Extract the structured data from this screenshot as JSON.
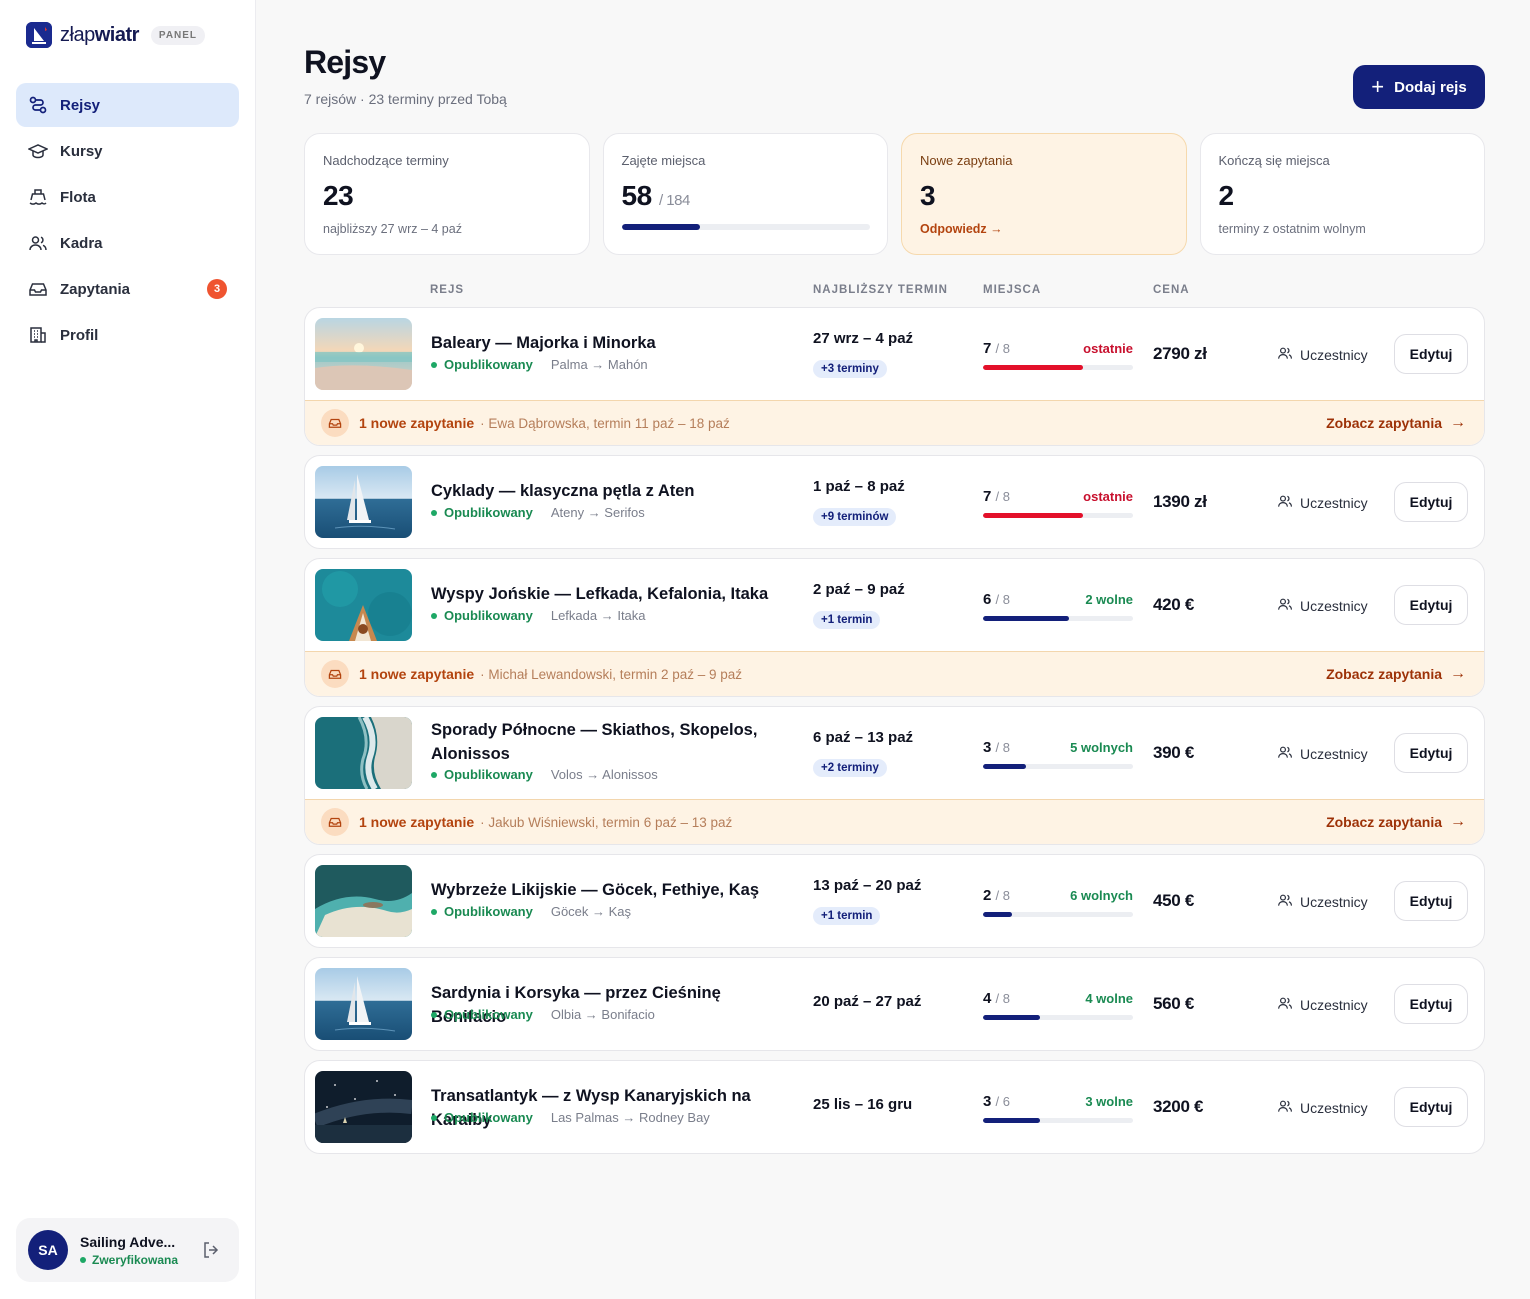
{
  "brand": {
    "name_light": "złap",
    "name_bold": "wiatr",
    "badge": "PANEL"
  },
  "nav": [
    {
      "label": "Rejsy",
      "icon": "route-icon",
      "active": true
    },
    {
      "label": "Kursy",
      "icon": "graduation-cap-icon"
    },
    {
      "label": "Flota",
      "icon": "boat-icon"
    },
    {
      "label": "Kadra",
      "icon": "users-icon"
    },
    {
      "label": "Zapytania",
      "icon": "inbox-icon",
      "badge": "3"
    },
    {
      "label": "Profil",
      "icon": "building-icon"
    }
  ],
  "account": {
    "initials": "SA",
    "name": "Sailing Adve...",
    "status": "Zweryfikowana"
  },
  "header": {
    "title": "Rejsy",
    "subtitle": "7 rejsów · 23 terminy przed Tobą",
    "add_label": "Dodaj rejs"
  },
  "stats": [
    {
      "label": "Nadchodzące terminy",
      "value": "23",
      "foot": "najbliższy 27 wrz – 4 paź"
    },
    {
      "label": "Zajęte miejsca",
      "value": "58",
      "of": "/ 184",
      "progress": 0.315
    },
    {
      "label": "Nowe zapytania",
      "value": "3",
      "foot": "Odpowiedz →"
    },
    {
      "label": "Kończą się miejsca",
      "value": "2",
      "foot": "terminy z ostatnim wolnym"
    }
  ],
  "table": {
    "columns": [
      "REJS",
      "NAJBLIŻSZY TERMIN",
      "MIEJSCA",
      "CENA"
    ],
    "status_label": "Opublikowany",
    "participants_label": "Uczestnicy",
    "edit_label": "Edytuj",
    "inquiry_link": "Zobacz zapytania"
  },
  "cruises": [
    {
      "name": "Baleary — Majorka i Minorka",
      "route": "Palma → Mahón",
      "date": "27 wrz – 4 paź",
      "terms": "+3 terminy",
      "taken": "7",
      "total": "/ 8",
      "tag": "ostatnie",
      "tag_type": "last",
      "price": "2790 zł",
      "photo": "beach-sunset",
      "inquiry": {
        "title": "1 nowe zapytanie",
        "detail": "· Ewa Dąbrowska, termin 11 paź – 18 paź"
      }
    },
    {
      "name": "Cyklady — klasyczna pętla z Aten",
      "route": "Ateny → Serifos",
      "date": "1 paź – 8 paź",
      "terms": "+9 terminów",
      "taken": "7",
      "total": "/ 8",
      "tag": "ostatnie",
      "tag_type": "last",
      "price": "1390 zł",
      "photo": "sailboat"
    },
    {
      "name": "Wyspy Jońskie — Lefkada, Kefalonia, Itaka",
      "route": "Lefkada → Itaka",
      "date": "2 paź – 9 paź",
      "terms": "+1 termin",
      "taken": "6",
      "total": "/ 8",
      "tag": "2 wolne",
      "tag_type": "free",
      "price": "420 €",
      "photo": "boat-bow",
      "inquiry": {
        "title": "1 nowe zapytanie",
        "detail": "· Michał Lewandowski, termin 2 paź – 9 paź"
      }
    },
    {
      "name": "Sporady Północne — Skiathos, Skopelos, Alonissos",
      "route": "Volos → Alonissos",
      "date": "6 paź – 13 paź",
      "terms": "+2 terminy",
      "taken": "3",
      "total": "/ 8",
      "tag": "5 wolnych",
      "tag_type": "free",
      "price": "390 €",
      "photo": "aerial-shore",
      "inquiry": {
        "title": "1 nowe zapytanie",
        "detail": "· Jakub Wiśniewski, termin 6 paź – 13 paź"
      }
    },
    {
      "name": "Wybrzeże Likijskie — Göcek, Fethiye, Kaş",
      "route": "Göcek → Kaş",
      "date": "13 paź – 20 paź",
      "terms": "+1 termin",
      "taken": "2",
      "total": "/ 8",
      "tag": "6 wolnych",
      "tag_type": "free",
      "price": "450 €",
      "photo": "aerial-lagoon"
    },
    {
      "name": "Sardynia i Korsyka — przez Cieśninę Bonifacio",
      "route": "Olbia → Bonifacio",
      "date": "20 paź – 27 paź",
      "terms": "",
      "taken": "4",
      "total": "/ 8",
      "tag": "4 wolne",
      "tag_type": "free",
      "price": "560 €",
      "photo": "sailboat"
    },
    {
      "name": "Transatlantyk — z Wysp Kanaryjskich na Karaiby",
      "route": "Las Palmas → Rodney Bay",
      "date": "25 lis – 16 gru",
      "terms": "",
      "taken": "3",
      "total": "/ 6",
      "tag": "3 wolne",
      "tag_type": "free",
      "price": "3200 €",
      "photo": "night-sky"
    }
  ]
}
